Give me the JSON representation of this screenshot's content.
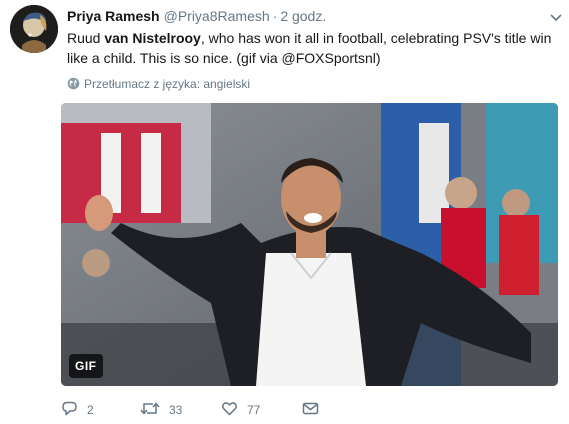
{
  "author": {
    "name": "Priya Ramesh",
    "handle": "@Priya8Ramesh",
    "separator": "·",
    "time": "2 godz."
  },
  "tweet": {
    "text_before": "Ruud ",
    "text_bold": "van Nistelrooy",
    "text_after": ", who has won it all in football, celebrating PSV's title win like a child. This is so nice. (gif via @FOXSportsnl)"
  },
  "translate": {
    "label": "Przetłumacz z języka: angielski",
    "icon": "globe-icon"
  },
  "media": {
    "badge": "GIF"
  },
  "actions": {
    "reply": {
      "icon": "reply-icon",
      "count": "2"
    },
    "retweet": {
      "icon": "retweet-icon",
      "count": "33"
    },
    "like": {
      "icon": "heart-icon",
      "count": "77"
    },
    "dm": {
      "icon": "envelope-icon"
    }
  },
  "colors": {
    "text": "#14171a",
    "secondary": "#657786",
    "background": "#ffffff"
  }
}
